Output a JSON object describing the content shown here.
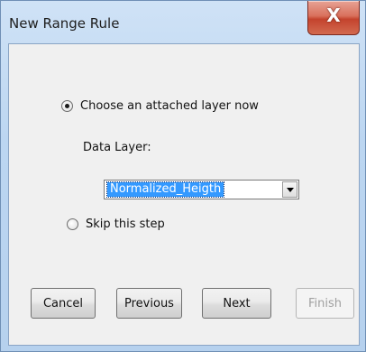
{
  "window": {
    "title": "New Range Rule",
    "close_label": "X"
  },
  "options": {
    "attach_label": "Choose an attached layer now",
    "attach_selected": true,
    "skip_label": "Skip this step",
    "skip_selected": false
  },
  "data_layer": {
    "label": "Data Layer:",
    "selected_value": "Normalized_Heigth"
  },
  "buttons": {
    "cancel": "Cancel",
    "previous": "Previous",
    "next": "Next",
    "finish": "Finish"
  },
  "icons": {
    "close": "close-icon",
    "dropdown": "chevron-down-icon"
  }
}
